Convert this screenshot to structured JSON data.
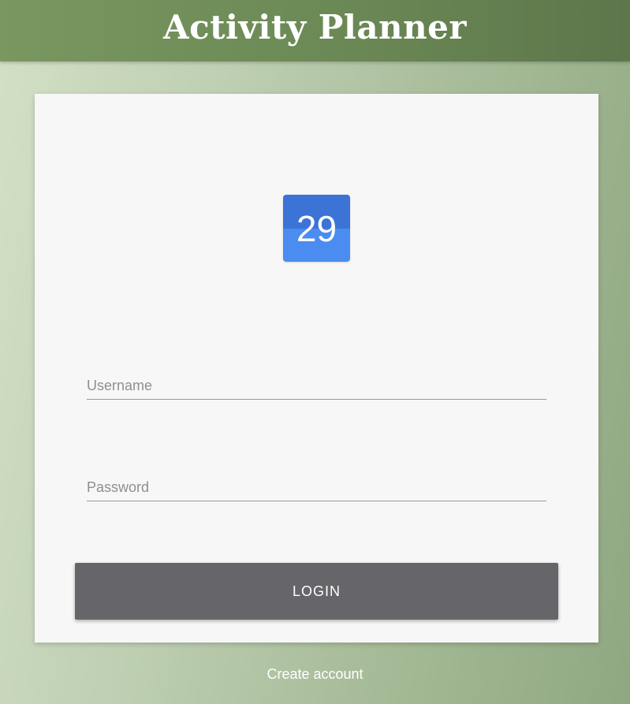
{
  "header": {
    "title": "Activity Planner"
  },
  "logo": {
    "icon": "calendar-icon",
    "day": "29",
    "colors": {
      "top": "#3c73d6",
      "bottom": "#4a8cef"
    }
  },
  "form": {
    "username": {
      "placeholder": "Username",
      "value": ""
    },
    "password": {
      "placeholder": "Password",
      "value": ""
    },
    "login_label": "LOGIN"
  },
  "footer": {
    "create_account_label": "Create account"
  },
  "colors": {
    "header": "#6c8a56",
    "card": "#f7f7f7",
    "button": "#666569"
  }
}
